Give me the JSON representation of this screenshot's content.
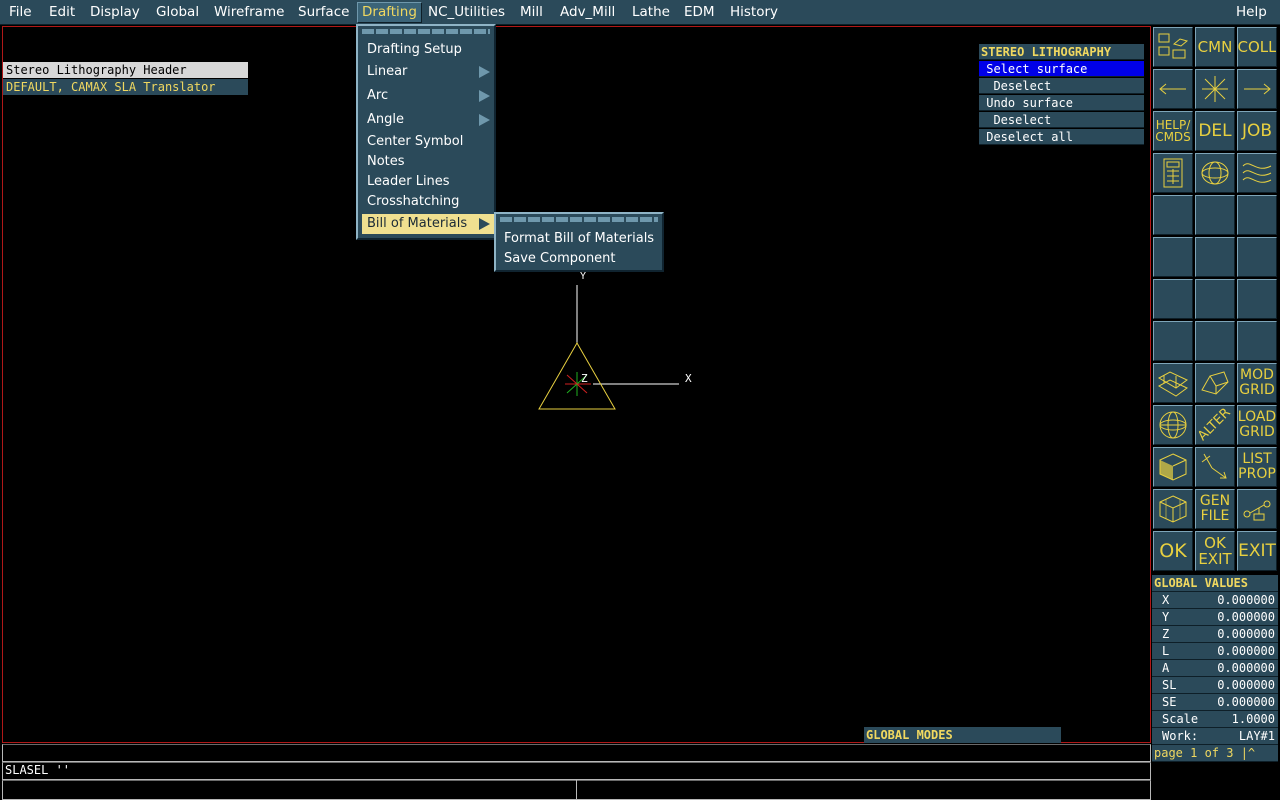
{
  "menubar": {
    "items": [
      "File",
      "Edit",
      "Display",
      "Global",
      "Wireframe",
      "Surface",
      "Drafting",
      "NC_Utilities",
      "Mill",
      "Adv_Mill",
      "Lathe",
      "EDM",
      "History"
    ],
    "help": "Help"
  },
  "header": {
    "title": "Stereo Lithography Header",
    "subtitle": "DEFAULT, CAMAX SLA Translator"
  },
  "drafting_menu": {
    "items": [
      "Drafting Setup",
      "Linear",
      "Arc",
      "Angle",
      "Center Symbol",
      "Notes",
      "Leader Lines",
      "Crosshatching",
      "Bill of Materials"
    ]
  },
  "bom_menu": {
    "items": [
      "Format Bill of Materials",
      "Save Component"
    ]
  },
  "axes": {
    "x": "X",
    "y": "Y",
    "z": "Z"
  },
  "sla_panel": {
    "title": "STEREO LITHOGRAPHY",
    "items": [
      " Select surface",
      "  Deselect",
      " Undo surface",
      "  Deselect",
      " Deselect all"
    ]
  },
  "icon_panel": {
    "cmn": "CMN",
    "coll": "COLL",
    "help": "HELP/ CMDS",
    "del": "DEL",
    "job": "JOB",
    "mod_grid": "MOD GRID",
    "alter": "ALTER",
    "load_grid": "LOAD GRID",
    "list_prop": "LIST PROP",
    "gen_file": "GEN FILE",
    "ok": "OK",
    "ok_exit": "OK EXIT",
    "exit": "EXIT"
  },
  "global_values": {
    "title": "GLOBAL VALUES",
    "rows": [
      {
        "label": "X",
        "value": "0.000000"
      },
      {
        "label": "Y",
        "value": "0.000000"
      },
      {
        "label": "Z",
        "value": "0.000000"
      },
      {
        "label": "L",
        "value": "0.000000"
      },
      {
        "label": "A",
        "value": "0.000000"
      },
      {
        "label": "SL",
        "value": "0.000000"
      },
      {
        "label": "SE",
        "value": "0.000000"
      }
    ],
    "scale_label": "Scale",
    "scale_value": "1.0000",
    "work_label": "Work:",
    "work_value": "LAY#1",
    "page": "page 1 of 3 |^"
  },
  "global_modes": "GLOBAL MODES",
  "command_line": "SLASEL ''",
  "colors": {
    "panel": "#2b4a5a",
    "accent_yellow": "#f0d860",
    "selection_blue": "#0000e8",
    "viewport_border": "#b01818"
  }
}
